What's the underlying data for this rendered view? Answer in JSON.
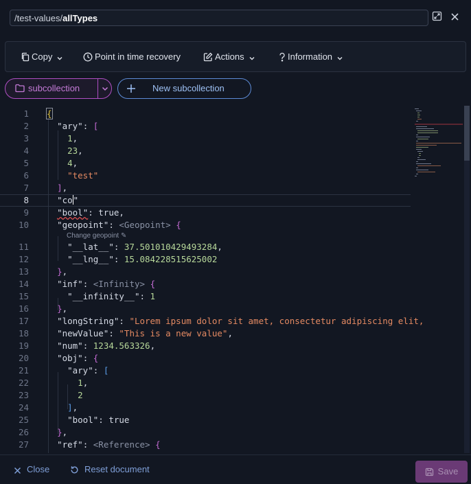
{
  "header": {
    "path_prefix": "/test-values/",
    "document_name": "allTypes"
  },
  "toolbar": {
    "copy_label": "Copy",
    "pitr_label": "Point in time recovery",
    "actions_label": "Actions",
    "information_label": "Information"
  },
  "subcollection": {
    "selected": "subcollection",
    "new_label": "New subcollection"
  },
  "editor": {
    "lines": [
      {
        "n": "1"
      },
      {
        "n": "2"
      },
      {
        "n": "3"
      },
      {
        "n": "4"
      },
      {
        "n": "5"
      },
      {
        "n": "6"
      },
      {
        "n": "7"
      },
      {
        "n": "8"
      },
      {
        "n": "9"
      },
      {
        "n": "10"
      },
      {
        "n": "11"
      },
      {
        "n": "12"
      },
      {
        "n": "13"
      },
      {
        "n": "14"
      },
      {
        "n": "15"
      },
      {
        "n": "16"
      },
      {
        "n": "17"
      },
      {
        "n": "18"
      },
      {
        "n": "19"
      },
      {
        "n": "20"
      },
      {
        "n": "21"
      },
      {
        "n": "22"
      },
      {
        "n": "23"
      },
      {
        "n": "24"
      },
      {
        "n": "25"
      },
      {
        "n": "26"
      },
      {
        "n": "27"
      }
    ],
    "text": {
      "ary_key": "\"ary\"",
      "v1": "1",
      "v23": "23",
      "v4": "4",
      "vtest": "\"test\"",
      "co_key_start": "\"co",
      "co_key_end": "\"",
      "bool_key": "\"bool\"",
      "bool_true": "true",
      "geopoint_key": "\"geopoint\"",
      "geopoint_tag": "<Geopoint>",
      "geopoint_hint": "Change geopoint ✎",
      "lat_key": "\"__lat__\"",
      "lat_val": "37.501010429493284",
      "lng_key": "\"__lng__\"",
      "lng_val": "15.084228515625002",
      "inf_key": "\"inf\"",
      "inf_tag": "<Infinity>",
      "infinity_key": "\"__infinity__\"",
      "infinity_val": "1",
      "longstring_key": "\"longString\"",
      "longstring_val": "\"Lorem ipsum dolor sit amet, consectetur adipiscing elit,",
      "newvalue_key": "\"newValue\"",
      "newvalue_val": "\"This is a new value\"",
      "num_key": "\"num\"",
      "num_val": "1234.563326",
      "obj_key": "\"obj\"",
      "obj_v1": "1",
      "obj_v2": "2",
      "obj_bool_key": "\"bool\"",
      "obj_bool_val": "true",
      "ref_key": "\"ref\"",
      "ref_tag": "<Reference>"
    }
  },
  "footer": {
    "close_label": "Close",
    "reset_label": "Reset document",
    "save_label": "Save"
  },
  "colors": {
    "background": "#121722",
    "subcollection_accent": "#b04fc4",
    "new_subcollection_accent": "#5d8bd6",
    "footer_link": "#7f9fd8",
    "save_disabled": "#6a3a75"
  },
  "icons": {
    "expand": "expand-icon",
    "close": "close-icon",
    "copy": "copy-icon",
    "clock": "clock-icon",
    "edit": "edit-icon",
    "help": "question-icon",
    "folder": "folder-icon",
    "plus": "plus-icon",
    "reset": "reset-icon",
    "save": "save-icon"
  }
}
